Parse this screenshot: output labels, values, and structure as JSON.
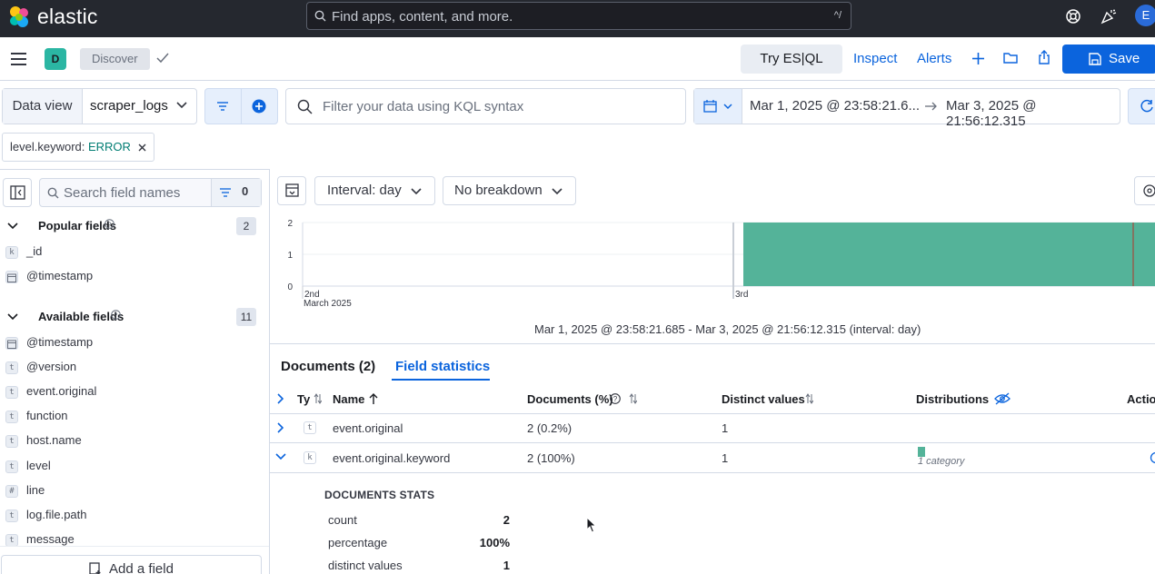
{
  "header": {
    "brand": "elastic",
    "search_placeholder": "Find apps, content, and more.",
    "search_shortcut": "^/",
    "avatar_initial": "E"
  },
  "appbar": {
    "space_initial": "D",
    "breadcrumb": "Discover",
    "try_esql": "Try ES|QL",
    "inspect": "Inspect",
    "alerts": "Alerts",
    "save": "Save"
  },
  "query": {
    "data_view_label": "Data view",
    "data_view_value": "scraper_logs",
    "kql_placeholder": "Filter your data using KQL syntax",
    "date_start": "Mar 1, 2025 @ 23:58:21.6...",
    "date_end": "Mar 3, 2025 @ 21:56:12.315"
  },
  "filter_pill": {
    "field": "level.keyword: ",
    "value": "ERROR"
  },
  "sidebar": {
    "search_placeholder": "Search field names",
    "filter_count": "0",
    "popular_title": "Popular fields",
    "popular_count": "2",
    "popular_fields": [
      {
        "type": "k",
        "name": "_id"
      },
      {
        "type": "cal",
        "name": "@timestamp"
      }
    ],
    "available_title": "Available fields",
    "available_count": "11",
    "available_fields": [
      {
        "type": "cal",
        "name": "@timestamp"
      },
      {
        "type": "t",
        "name": "@version"
      },
      {
        "type": "t",
        "name": "event.original"
      },
      {
        "type": "t",
        "name": "function"
      },
      {
        "type": "t",
        "name": "host.name"
      },
      {
        "type": "t",
        "name": "level"
      },
      {
        "type": "#",
        "name": "line"
      },
      {
        "type": "t",
        "name": "log.file.path"
      },
      {
        "type": "t",
        "name": "message"
      }
    ],
    "add_field": "Add a field"
  },
  "histogram": {
    "interval_label": "Interval: day",
    "breakdown_label": "No breakdown",
    "caption": "Mar 1, 2025 @ 23:58:21.685 - Mar 3, 2025 @ 21:56:12.315 (interval: day)",
    "bar_color": "#54b399"
  },
  "chart_data": {
    "type": "bar",
    "categories": [
      "2nd",
      "3rd"
    ],
    "values": [
      0,
      2
    ],
    "y_ticks": [
      "0",
      "1",
      "2"
    ],
    "x_tick_labels": [
      "2nd",
      "3rd"
    ],
    "x_sub_label": "March 2025",
    "ylim": [
      0,
      2
    ]
  },
  "tabs": {
    "documents": "Documents (2)",
    "field_stats": "Field statistics"
  },
  "table": {
    "headers": {
      "type": "Ty",
      "name": "Name",
      "documents": "Documents (%)",
      "distinct": "Distinct values",
      "distributions": "Distributions",
      "actions": "Actio"
    },
    "rows": [
      {
        "type": "t",
        "name": "event.original",
        "docs": "2 (0.2%)",
        "distinct": "1",
        "dist": ""
      },
      {
        "type": "k",
        "name": "event.original.keyword",
        "docs": "2 (100%)",
        "distinct": "1",
        "dist": "1 category"
      }
    ]
  },
  "doc_stats": {
    "title": "DOCUMENTS STATS",
    "rows": [
      {
        "k": "count",
        "v": "2"
      },
      {
        "k": "percentage",
        "v": "100%"
      },
      {
        "k": "distinct values",
        "v": "1"
      }
    ]
  }
}
